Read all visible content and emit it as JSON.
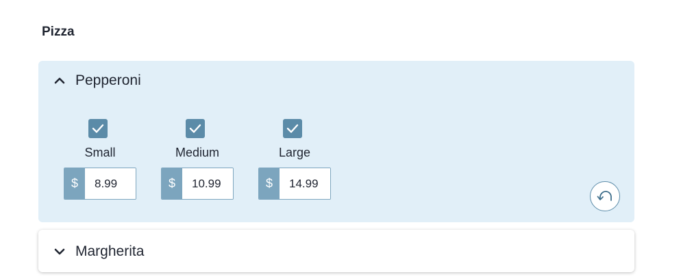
{
  "section": {
    "title": "Pizza"
  },
  "items": [
    {
      "name": "Pepperoni",
      "expanded": true,
      "sizes": [
        {
          "label": "Small",
          "checked": true,
          "currency": "$",
          "price": "8.99"
        },
        {
          "label": "Medium",
          "checked": true,
          "currency": "$",
          "price": "10.99"
        },
        {
          "label": "Large",
          "checked": true,
          "currency": "$",
          "price": "14.99"
        }
      ],
      "reset_icon": "undo-icon"
    },
    {
      "name": "Margherita",
      "expanded": false
    }
  ],
  "colors": {
    "panel_bg": "#e1eff8",
    "accent": "#5b8ba8",
    "currency_bg": "#7ca5be"
  }
}
